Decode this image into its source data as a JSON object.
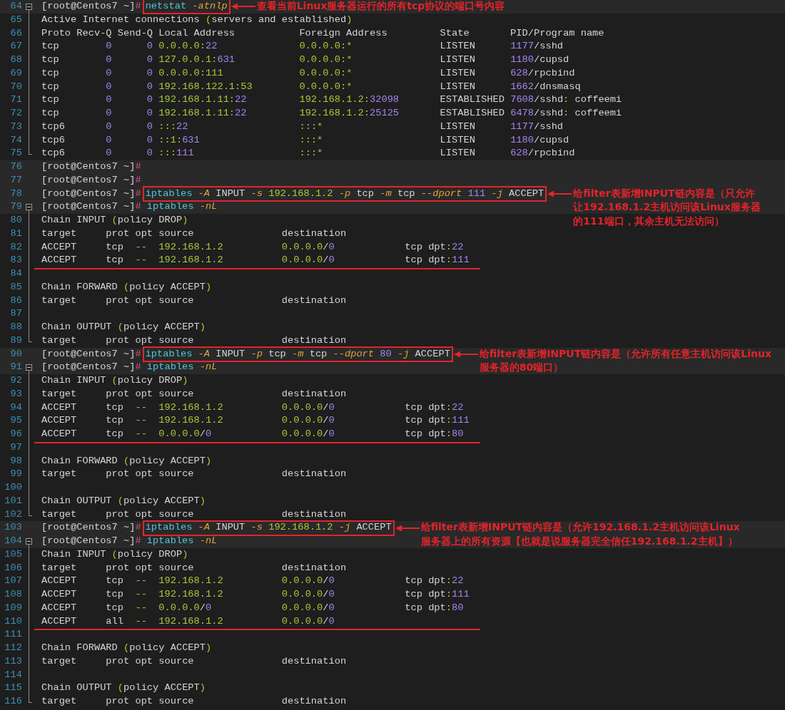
{
  "lines": [
    {
      "number": "64",
      "prompt": "[root@Centos7 ~]",
      "symbol": "#",
      "command": {
        "boxed": true,
        "segments": [
          {
            "kind": "command",
            "text": "netstat "
          },
          {
            "kind": "option",
            "text": "-atnlp"
          }
        ]
      },
      "note": {
        "lines": [
          "查看当前Linux服务器运行的所有tcp协议的端口号内容"
        ]
      },
      "children": [
        {
          "number": "65",
          "underlined": false,
          "segments": [
            {
              "kind": "text",
              "text": "Active Internet connections "
            },
            {
              "kind": "address",
              "text": "("
            },
            {
              "kind": "text",
              "text": "servers and established"
            },
            {
              "kind": "address",
              "text": ")"
            }
          ]
        },
        {
          "number": "66",
          "underlined": false,
          "segments": [
            {
              "kind": "text",
              "text": "Proto Recv-Q Send-Q Local Address           Foreign Address         State       PID/Program name"
            }
          ]
        },
        {
          "number": "67",
          "underlined": false,
          "segments": [
            {
              "kind": "text",
              "text": "tcp        "
            },
            {
              "kind": "number",
              "text": "0      "
            },
            {
              "kind": "number",
              "text": "0 "
            },
            {
              "kind": "address",
              "text": "0.0.0.0:"
            },
            {
              "kind": "number",
              "text": "22              "
            },
            {
              "kind": "address",
              "text": "0.0.0.0:*"
            },
            {
              "kind": "text",
              "text": "               LISTEN      "
            },
            {
              "kind": "number",
              "text": "1177"
            },
            {
              "kind": "text",
              "text": "/sshd"
            }
          ]
        },
        {
          "number": "68",
          "underlined": false,
          "segments": [
            {
              "kind": "text",
              "text": "tcp        "
            },
            {
              "kind": "number",
              "text": "0      "
            },
            {
              "kind": "number",
              "text": "0 "
            },
            {
              "kind": "address",
              "text": "127.0.0.1:"
            },
            {
              "kind": "number",
              "text": "631           "
            },
            {
              "kind": "address",
              "text": "0.0.0.0:*"
            },
            {
              "kind": "text",
              "text": "               LISTEN      "
            },
            {
              "kind": "number",
              "text": "1180"
            },
            {
              "kind": "text",
              "text": "/cupsd"
            }
          ]
        },
        {
          "number": "69",
          "underlined": false,
          "segments": [
            {
              "kind": "text",
              "text": "tcp        "
            },
            {
              "kind": "number",
              "text": "0      "
            },
            {
              "kind": "number",
              "text": "0 "
            },
            {
              "kind": "address",
              "text": "0.0.0.0:111             "
            },
            {
              "kind": "address",
              "text": "0.0.0.0:*"
            },
            {
              "kind": "text",
              "text": "               LISTEN      "
            },
            {
              "kind": "number",
              "text": "628"
            },
            {
              "kind": "text",
              "text": "/rpcbind"
            }
          ]
        },
        {
          "number": "70",
          "underlined": false,
          "segments": [
            {
              "kind": "text",
              "text": "tcp        "
            },
            {
              "kind": "number",
              "text": "0      "
            },
            {
              "kind": "number",
              "text": "0 "
            },
            {
              "kind": "address",
              "text": "192.168.122.1:53        "
            },
            {
              "kind": "address",
              "text": "0.0.0.0:*"
            },
            {
              "kind": "text",
              "text": "               LISTEN      "
            },
            {
              "kind": "number",
              "text": "1662"
            },
            {
              "kind": "text",
              "text": "/dnsmasq"
            }
          ]
        },
        {
          "number": "71",
          "underlined": false,
          "segments": [
            {
              "kind": "text",
              "text": "tcp        "
            },
            {
              "kind": "number",
              "text": "0      "
            },
            {
              "kind": "number",
              "text": "0 "
            },
            {
              "kind": "address",
              "text": "192.168.1.11:"
            },
            {
              "kind": "number",
              "text": "22         "
            },
            {
              "kind": "address",
              "text": "192.168.1.2:"
            },
            {
              "kind": "number",
              "text": "32098"
            },
            {
              "kind": "text",
              "text": "       ESTABLISHED "
            },
            {
              "kind": "number",
              "text": "7608"
            },
            {
              "kind": "text",
              "text": "/sshd"
            },
            {
              "kind": "address",
              "text": ":"
            },
            {
              "kind": "text",
              "text": " coffeemi"
            }
          ]
        },
        {
          "number": "72",
          "underlined": false,
          "segments": [
            {
              "kind": "text",
              "text": "tcp        "
            },
            {
              "kind": "number",
              "text": "0      "
            },
            {
              "kind": "number",
              "text": "0 "
            },
            {
              "kind": "address",
              "text": "192.168.1.11:"
            },
            {
              "kind": "number",
              "text": "22         "
            },
            {
              "kind": "address",
              "text": "192.168.1.2:"
            },
            {
              "kind": "number",
              "text": "25125"
            },
            {
              "kind": "text",
              "text": "       ESTABLISHED "
            },
            {
              "kind": "number",
              "text": "6478"
            },
            {
              "kind": "text",
              "text": "/sshd"
            },
            {
              "kind": "address",
              "text": ":"
            },
            {
              "kind": "text",
              "text": " coffeemi"
            }
          ]
        },
        {
          "number": "73",
          "underlined": false,
          "segments": [
            {
              "kind": "text",
              "text": "tcp6       "
            },
            {
              "kind": "number",
              "text": "0      "
            },
            {
              "kind": "number",
              "text": "0 "
            },
            {
              "kind": "address",
              "text": ":::"
            },
            {
              "kind": "number",
              "text": "22                   "
            },
            {
              "kind": "address",
              "text": ":::*"
            },
            {
              "kind": "text",
              "text": "                    LISTEN      "
            },
            {
              "kind": "number",
              "text": "1177"
            },
            {
              "kind": "text",
              "text": "/sshd"
            }
          ]
        },
        {
          "number": "74",
          "underlined": false,
          "segments": [
            {
              "kind": "text",
              "text": "tcp6       "
            },
            {
              "kind": "number",
              "text": "0      "
            },
            {
              "kind": "number",
              "text": "0 "
            },
            {
              "kind": "address",
              "text": "::1:"
            },
            {
              "kind": "number",
              "text": "631                 "
            },
            {
              "kind": "address",
              "text": ":::*"
            },
            {
              "kind": "text",
              "text": "                    LISTEN      "
            },
            {
              "kind": "number",
              "text": "1180"
            },
            {
              "kind": "text",
              "text": "/cupsd"
            }
          ]
        },
        {
          "number": "75",
          "underlined": false,
          "segments": [
            {
              "kind": "text",
              "text": "tcp6       "
            },
            {
              "kind": "number",
              "text": "0      "
            },
            {
              "kind": "number",
              "text": "0 "
            },
            {
              "kind": "address",
              "text": ":::"
            },
            {
              "kind": "number",
              "text": "111                  "
            },
            {
              "kind": "address",
              "text": ":::*"
            },
            {
              "kind": "text",
              "text": "                    LISTEN      "
            },
            {
              "kind": "number",
              "text": "628"
            },
            {
              "kind": "text",
              "text": "/rpcbind"
            }
          ]
        }
      ]
    },
    {
      "number": "76",
      "prompt": "[root@Centos7 ~]",
      "symbol": "#"
    },
    {
      "number": "77",
      "prompt": "[root@Centos7 ~]",
      "symbol": "#"
    },
    {
      "number": "78",
      "prompt": "[root@Centos7 ~]",
      "symbol": "#",
      "command": {
        "boxed": true,
        "segments": [
          {
            "kind": "command",
            "text": "iptables "
          },
          {
            "kind": "option",
            "text": "-A"
          },
          {
            "kind": "text",
            "text": " INPUT "
          },
          {
            "kind": "option",
            "text": "-s "
          },
          {
            "kind": "address",
            "text": "192.168.1.2 "
          },
          {
            "kind": "option",
            "text": "-p"
          },
          {
            "kind": "text",
            "text": " tcp "
          },
          {
            "kind": "option",
            "text": "-m"
          },
          {
            "kind": "text",
            "text": " tcp "
          },
          {
            "kind": "option",
            "text": "--dport "
          },
          {
            "kind": "number",
            "text": "111 "
          },
          {
            "kind": "option",
            "text": "-j"
          },
          {
            "kind": "text",
            "text": " ACCEPT"
          }
        ]
      },
      "note": {
        "lines": [
          "给filter表新增INPUT链内容是（只允许",
          "让192.168.1.2主机访问该Linux服务器",
          "的111端口，其余主机无法访问）"
        ]
      }
    },
    {
      "number": "79",
      "prompt": "[root@Centos7 ~]",
      "symbol": "#",
      "command": {
        "boxed": false,
        "segments": [
          {
            "kind": "command",
            "text": "iptables "
          },
          {
            "kind": "option",
            "text": "-nL"
          }
        ]
      },
      "children": [
        {
          "number": "80",
          "underlined": false,
          "segments": [
            {
              "kind": "text",
              "text": "Chain INPUT "
            },
            {
              "kind": "address",
              "text": "("
            },
            {
              "kind": "text",
              "text": "policy DROP"
            },
            {
              "kind": "address",
              "text": ")"
            }
          ]
        },
        {
          "number": "81",
          "underlined": false,
          "segments": [
            {
              "kind": "text",
              "text": "target     prot opt source               destination"
            }
          ]
        },
        {
          "number": "82",
          "underlined": false,
          "segments": [
            {
              "kind": "text",
              "text": "ACCEPT     tcp  "
            },
            {
              "kind": "address",
              "text": "--  "
            },
            {
              "kind": "address",
              "text": "192.168.1.2          "
            },
            {
              "kind": "address",
              "text": "0.0.0.0"
            },
            {
              "kind": "text",
              "text": "/"
            },
            {
              "kind": "number",
              "text": "0"
            },
            {
              "kind": "text",
              "text": "            tcp dpt"
            },
            {
              "kind": "address",
              "text": ":"
            },
            {
              "kind": "number",
              "text": "22"
            }
          ]
        },
        {
          "number": "83",
          "underlined": true,
          "segments": [
            {
              "kind": "text",
              "text": "ACCEPT     tcp  "
            },
            {
              "kind": "address",
              "text": "--  "
            },
            {
              "kind": "address",
              "text": "192.168.1.2          "
            },
            {
              "kind": "address",
              "text": "0.0.0.0"
            },
            {
              "kind": "text",
              "text": "/"
            },
            {
              "kind": "number",
              "text": "0"
            },
            {
              "kind": "text",
              "text": "            tcp dpt"
            },
            {
              "kind": "address",
              "text": ":"
            },
            {
              "kind": "number",
              "text": "111"
            }
          ]
        },
        {
          "number": "84",
          "underlined": false
        },
        {
          "number": "85",
          "underlined": false,
          "segments": [
            {
              "kind": "text",
              "text": "Chain FORWARD "
            },
            {
              "kind": "address",
              "text": "("
            },
            {
              "kind": "text",
              "text": "policy ACCEPT"
            },
            {
              "kind": "address",
              "text": ")"
            }
          ]
        },
        {
          "number": "86",
          "underlined": false,
          "segments": [
            {
              "kind": "text",
              "text": "target     prot opt source               destination"
            }
          ]
        },
        {
          "number": "87",
          "underlined": false
        },
        {
          "number": "88",
          "underlined": false,
          "segments": [
            {
              "kind": "text",
              "text": "Chain OUTPUT "
            },
            {
              "kind": "address",
              "text": "("
            },
            {
              "kind": "text",
              "text": "policy ACCEPT"
            },
            {
              "kind": "address",
              "text": ")"
            }
          ]
        },
        {
          "number": "89",
          "underlined": false,
          "segments": [
            {
              "kind": "text",
              "text": "target     prot opt source               destination"
            }
          ]
        }
      ]
    },
    {
      "number": "90",
      "prompt": "[root@Centos7 ~]",
      "symbol": "#",
      "command": {
        "boxed": true,
        "segments": [
          {
            "kind": "command",
            "text": "iptables "
          },
          {
            "kind": "option",
            "text": "-A"
          },
          {
            "kind": "text",
            "text": " INPUT "
          },
          {
            "kind": "option",
            "text": "-p"
          },
          {
            "kind": "text",
            "text": " tcp "
          },
          {
            "kind": "option",
            "text": "-m"
          },
          {
            "kind": "text",
            "text": " tcp "
          },
          {
            "kind": "option",
            "text": "--dport "
          },
          {
            "kind": "number",
            "text": "80 "
          },
          {
            "kind": "option",
            "text": "-j"
          },
          {
            "kind": "text",
            "text": " ACCEPT"
          }
        ]
      },
      "note": {
        "lines": [
          "给filter表新增INPUT链内容是（允许所有任意主机访问该Linux",
          "服务器的80端口）"
        ]
      }
    },
    {
      "number": "91",
      "prompt": "[root@Centos7 ~]",
      "symbol": "#",
      "command": {
        "boxed": false,
        "segments": [
          {
            "kind": "command",
            "text": "iptables "
          },
          {
            "kind": "option",
            "text": "-nL"
          }
        ]
      },
      "children": [
        {
          "number": "92",
          "underlined": false,
          "segments": [
            {
              "kind": "text",
              "text": "Chain INPUT "
            },
            {
              "kind": "address",
              "text": "("
            },
            {
              "kind": "text",
              "text": "policy DROP"
            },
            {
              "kind": "address",
              "text": ")"
            }
          ]
        },
        {
          "number": "93",
          "underlined": false,
          "segments": [
            {
              "kind": "text",
              "text": "target     prot opt source               destination"
            }
          ]
        },
        {
          "number": "94",
          "underlined": false,
          "segments": [
            {
              "kind": "text",
              "text": "ACCEPT     tcp  "
            },
            {
              "kind": "address",
              "text": "--  "
            },
            {
              "kind": "address",
              "text": "192.168.1.2          "
            },
            {
              "kind": "address",
              "text": "0.0.0.0"
            },
            {
              "kind": "text",
              "text": "/"
            },
            {
              "kind": "number",
              "text": "0"
            },
            {
              "kind": "text",
              "text": "            tcp dpt"
            },
            {
              "kind": "address",
              "text": ":"
            },
            {
              "kind": "number",
              "text": "22"
            }
          ]
        },
        {
          "number": "95",
          "underlined": false,
          "segments": [
            {
              "kind": "text",
              "text": "ACCEPT     tcp  "
            },
            {
              "kind": "address",
              "text": "--  "
            },
            {
              "kind": "address",
              "text": "192.168.1.2          "
            },
            {
              "kind": "address",
              "text": "0.0.0.0"
            },
            {
              "kind": "text",
              "text": "/"
            },
            {
              "kind": "number",
              "text": "0"
            },
            {
              "kind": "text",
              "text": "            tcp dpt"
            },
            {
              "kind": "address",
              "text": ":"
            },
            {
              "kind": "number",
              "text": "111"
            }
          ]
        },
        {
          "number": "96",
          "underlined": true,
          "segments": [
            {
              "kind": "text",
              "text": "ACCEPT     tcp  "
            },
            {
              "kind": "address",
              "text": "--  "
            },
            {
              "kind": "address",
              "text": "0.0.0.0"
            },
            {
              "kind": "text",
              "text": "/"
            },
            {
              "kind": "number",
              "text": "0            "
            },
            {
              "kind": "address",
              "text": "0.0.0.0"
            },
            {
              "kind": "text",
              "text": "/"
            },
            {
              "kind": "number",
              "text": "0"
            },
            {
              "kind": "text",
              "text": "            tcp dpt"
            },
            {
              "kind": "address",
              "text": ":"
            },
            {
              "kind": "number",
              "text": "80"
            }
          ]
        },
        {
          "number": "97",
          "underlined": false
        },
        {
          "number": "98",
          "underlined": false,
          "segments": [
            {
              "kind": "text",
              "text": "Chain FORWARD "
            },
            {
              "kind": "address",
              "text": "("
            },
            {
              "kind": "text",
              "text": "policy ACCEPT"
            },
            {
              "kind": "address",
              "text": ")"
            }
          ]
        },
        {
          "number": "99",
          "underlined": false,
          "segments": [
            {
              "kind": "text",
              "text": "target     prot opt source               destination"
            }
          ]
        },
        {
          "number": "100",
          "underlined": false
        },
        {
          "number": "101",
          "underlined": false,
          "segments": [
            {
              "kind": "text",
              "text": "Chain OUTPUT "
            },
            {
              "kind": "address",
              "text": "("
            },
            {
              "kind": "text",
              "text": "policy ACCEPT"
            },
            {
              "kind": "address",
              "text": ")"
            }
          ]
        },
        {
          "number": "102",
          "underlined": false,
          "segments": [
            {
              "kind": "text",
              "text": "target     prot opt source               destination"
            }
          ]
        }
      ]
    },
    {
      "number": "103",
      "prompt": "[root@Centos7 ~]",
      "symbol": "#",
      "command": {
        "boxed": true,
        "segments": [
          {
            "kind": "command",
            "text": "iptables "
          },
          {
            "kind": "option",
            "text": "-A"
          },
          {
            "kind": "text",
            "text": " INPUT "
          },
          {
            "kind": "option",
            "text": "-s "
          },
          {
            "kind": "address",
            "text": "192.168.1.2 "
          },
          {
            "kind": "option",
            "text": "-j"
          },
          {
            "kind": "text",
            "text": " ACCEPT"
          }
        ]
      },
      "note": {
        "lines": [
          "给filter表新增INPUT链内容是（允许192.168.1.2主机访问该Linux",
          "服务器上的所有资源【也就是说服务器完全信任192.168.1.2主机】）"
        ]
      }
    },
    {
      "number": "104",
      "prompt": "[root@Centos7 ~]",
      "symbol": "#",
      "command": {
        "boxed": false,
        "segments": [
          {
            "kind": "command",
            "text": "iptables "
          },
          {
            "kind": "option",
            "text": "-nL"
          }
        ]
      },
      "children": [
        {
          "number": "105",
          "underlined": false,
          "segments": [
            {
              "kind": "text",
              "text": "Chain INPUT "
            },
            {
              "kind": "address",
              "text": "("
            },
            {
              "kind": "text",
              "text": "policy DROP"
            },
            {
              "kind": "address",
              "text": ")"
            }
          ]
        },
        {
          "number": "106",
          "underlined": false,
          "segments": [
            {
              "kind": "text",
              "text": "target     prot opt source               destination"
            }
          ]
        },
        {
          "number": "107",
          "underlined": false,
          "segments": [
            {
              "kind": "text",
              "text": "ACCEPT     tcp  "
            },
            {
              "kind": "address",
              "text": "--  "
            },
            {
              "kind": "address",
              "text": "192.168.1.2          "
            },
            {
              "kind": "address",
              "text": "0.0.0.0"
            },
            {
              "kind": "text",
              "text": "/"
            },
            {
              "kind": "number",
              "text": "0"
            },
            {
              "kind": "text",
              "text": "            tcp dpt"
            },
            {
              "kind": "address",
              "text": ":"
            },
            {
              "kind": "number",
              "text": "22"
            }
          ]
        },
        {
          "number": "108",
          "underlined": false,
          "segments": [
            {
              "kind": "text",
              "text": "ACCEPT     tcp  "
            },
            {
              "kind": "address",
              "text": "--  "
            },
            {
              "kind": "address",
              "text": "192.168.1.2          "
            },
            {
              "kind": "address",
              "text": "0.0.0.0"
            },
            {
              "kind": "text",
              "text": "/"
            },
            {
              "kind": "number",
              "text": "0"
            },
            {
              "kind": "text",
              "text": "            tcp dpt"
            },
            {
              "kind": "address",
              "text": ":"
            },
            {
              "kind": "number",
              "text": "111"
            }
          ]
        },
        {
          "number": "109",
          "underlined": false,
          "segments": [
            {
              "kind": "text",
              "text": "ACCEPT     tcp  "
            },
            {
              "kind": "address",
              "text": "--  "
            },
            {
              "kind": "address",
              "text": "0.0.0.0"
            },
            {
              "kind": "text",
              "text": "/"
            },
            {
              "kind": "number",
              "text": "0            "
            },
            {
              "kind": "address",
              "text": "0.0.0.0"
            },
            {
              "kind": "text",
              "text": "/"
            },
            {
              "kind": "number",
              "text": "0"
            },
            {
              "kind": "text",
              "text": "            tcp dpt"
            },
            {
              "kind": "address",
              "text": ":"
            },
            {
              "kind": "number",
              "text": "80"
            }
          ]
        },
        {
          "number": "110",
          "underlined": true,
          "segments": [
            {
              "kind": "text",
              "text": "ACCEPT     all  "
            },
            {
              "kind": "address",
              "text": "--  "
            },
            {
              "kind": "address",
              "text": "192.168.1.2          "
            },
            {
              "kind": "address",
              "text": "0.0.0.0"
            },
            {
              "kind": "text",
              "text": "/"
            },
            {
              "kind": "number",
              "text": "0"
            }
          ]
        },
        {
          "number": "111",
          "underlined": false
        },
        {
          "number": "112",
          "underlined": false,
          "segments": [
            {
              "kind": "text",
              "text": "Chain FORWARD "
            },
            {
              "kind": "address",
              "text": "("
            },
            {
              "kind": "text",
              "text": "policy ACCEPT"
            },
            {
              "kind": "address",
              "text": ")"
            }
          ]
        },
        {
          "number": "113",
          "underlined": false,
          "segments": [
            {
              "kind": "text",
              "text": "target     prot opt source               destination"
            }
          ]
        },
        {
          "number": "114",
          "underlined": false
        },
        {
          "number": "115",
          "underlined": false,
          "segments": [
            {
              "kind": "text",
              "text": "Chain OUTPUT "
            },
            {
              "kind": "address",
              "text": "("
            },
            {
              "kind": "text",
              "text": "policy ACCEPT"
            },
            {
              "kind": "address",
              "text": ")"
            }
          ]
        },
        {
          "number": "116",
          "underlined": false,
          "segments": [
            {
              "kind": "text",
              "text": "target     prot opt source               destination"
            }
          ]
        }
      ]
    }
  ]
}
